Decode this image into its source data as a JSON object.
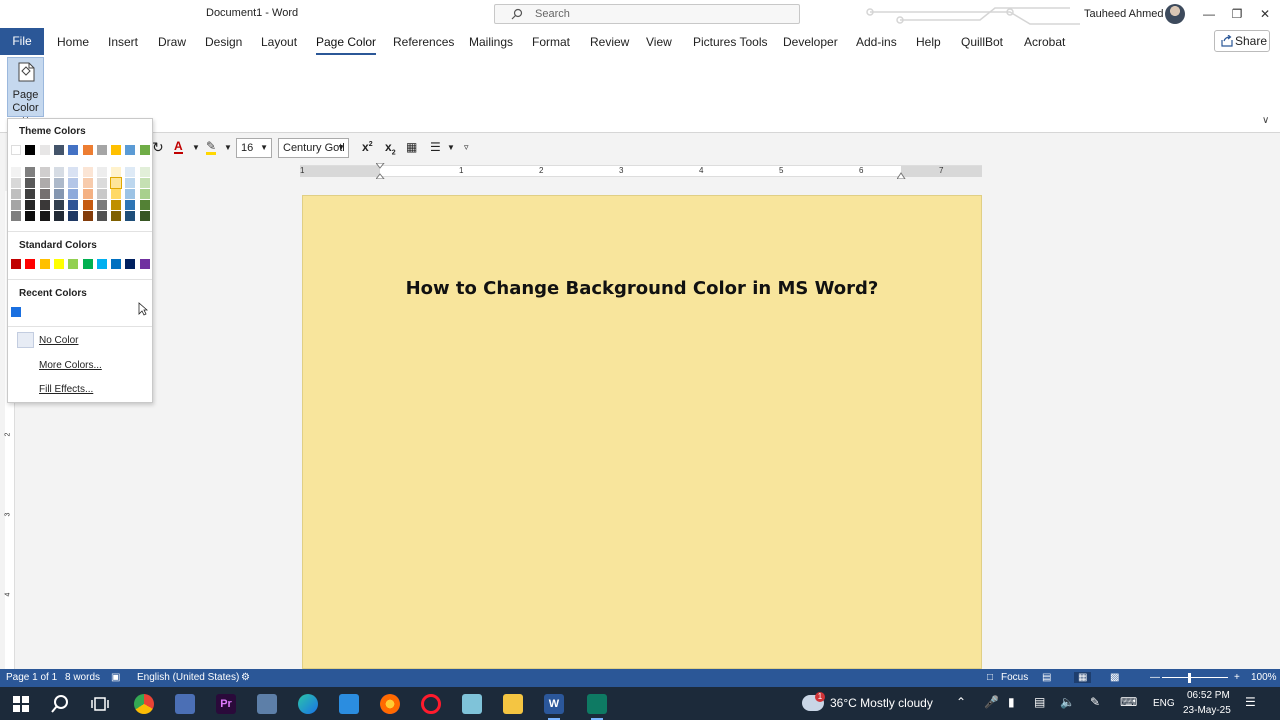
{
  "window": {
    "title": "Document1  -  Word",
    "search_placeholder": "Search",
    "user_name": "Tauheed Ahmed"
  },
  "menu": {
    "file": "File",
    "tabs": [
      "Home",
      "Insert",
      "Draw",
      "Design",
      "Layout",
      "Page Color",
      "References",
      "Mailings",
      "Format",
      "Review",
      "View",
      "Pictures Tools",
      "Developer",
      "Add-ins",
      "Help",
      "QuillBot",
      "Acrobat"
    ],
    "active_tab": "Page Color",
    "share": "Share"
  },
  "ribbon": {
    "page_color_line1": "Page",
    "page_color_line2": "Color ˅"
  },
  "format_toolbar": {
    "font_size": "16",
    "font_name": "Century Gotl"
  },
  "ruler": {
    "h_numbers": [
      "1",
      "1",
      "2",
      "3",
      "4",
      "5",
      "6",
      "7"
    ],
    "v_numbers": [
      "2",
      "3",
      "4"
    ]
  },
  "document": {
    "heading": "How to Change Background Color in MS Word?",
    "page_color": "#f8e59c"
  },
  "dropdown": {
    "theme_heading": "Theme Colors",
    "standard_heading": "Standard Colors",
    "recent_heading": "Recent Colors",
    "no_color": "No Color",
    "more_colors": "More Colors...",
    "fill_effects": "Fill Effects...",
    "theme_colors": [
      "#ffffff",
      "#000000",
      "#e7e6e6",
      "#44546a",
      "#4472c4",
      "#ed7d31",
      "#a5a5a5",
      "#ffc000",
      "#5b9bd5",
      "#70ad47"
    ],
    "theme_shades": [
      [
        "#f2f2f2",
        "#7f7f7f",
        "#d0cece",
        "#d6dce4",
        "#d9e2f3",
        "#fbe5d5",
        "#ededed",
        "#fff2cc",
        "#deeaf6",
        "#e2efd9"
      ],
      [
        "#d8d8d8",
        "#595959",
        "#aeabab",
        "#adb9ca",
        "#b4c6e7",
        "#f7cbac",
        "#dbdbdb",
        "#fee599",
        "#bdd7ee",
        "#c5e0b3"
      ],
      [
        "#bfbfbf",
        "#3f3f3f",
        "#757070",
        "#8496b0",
        "#8eaadb",
        "#f4b183",
        "#c9c9c9",
        "#ffd965",
        "#9cc3e5",
        "#a8d08d"
      ],
      [
        "#a5a5a5",
        "#262626",
        "#3a3838",
        "#323f4f",
        "#2f5496",
        "#c55a11",
        "#7b7b7b",
        "#bf8f00",
        "#2e75b5",
        "#538135"
      ],
      [
        "#7f7f7f",
        "#0c0c0c",
        "#171616",
        "#222a35",
        "#1e3864",
        "#833c0b",
        "#525252",
        "#7f6000",
        "#1e4e79",
        "#375623"
      ]
    ],
    "standard_colors": [
      "#c00000",
      "#ff0000",
      "#ffc000",
      "#ffff00",
      "#92d050",
      "#00b050",
      "#00b0f0",
      "#0070c0",
      "#002060",
      "#7030a0"
    ],
    "recent_colors": [
      "#1a6fe0"
    ]
  },
  "status": {
    "page": "Page 1 of 1",
    "words": "8 words",
    "language": "English (United States)",
    "focus": "Focus",
    "zoom": "100%"
  },
  "taskbar": {
    "weather": "36°C  Mostly cloudy",
    "weather_badge": "1",
    "lang": "ENG",
    "time": "06:52 PM",
    "date": "23-May-25"
  }
}
